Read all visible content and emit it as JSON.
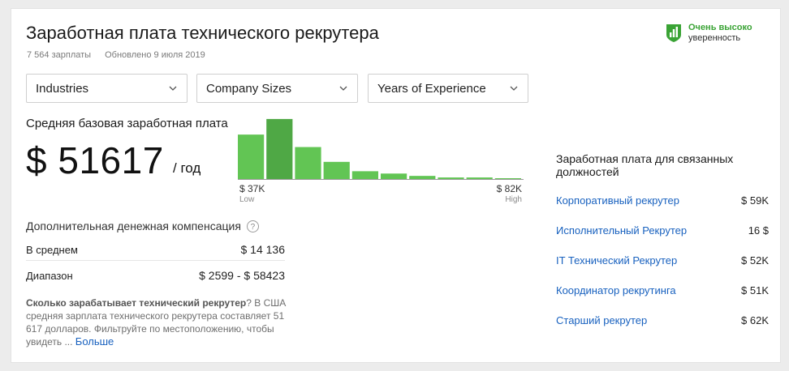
{
  "header": {
    "title": "Заработная плата технического рекрутера",
    "salary_count": "7 564 зарплаты",
    "updated": "Обновлено 9 июля 2019"
  },
  "confidence": {
    "level": "Очень высоко",
    "label": "уверенность",
    "color": "#3aa335",
    "icon": "shield-chart-icon"
  },
  "filters": [
    {
      "label": "Industries",
      "icon": "chevron-down-icon"
    },
    {
      "label": "Company Sizes",
      "icon": "chevron-down-icon"
    },
    {
      "label": "Years of Experience",
      "icon": "chevron-down-icon"
    }
  ],
  "base_pay": {
    "label": "Средняя базовая заработная плата",
    "amount": "$ 51617",
    "period": "/ год"
  },
  "chart_data": {
    "type": "bar",
    "title": "",
    "xlabel": "",
    "ylabel": "",
    "categories": [
      "1",
      "2",
      "3",
      "4",
      "5",
      "6",
      "7",
      "8",
      "9",
      "10"
    ],
    "values": [
      57,
      77,
      41,
      22,
      10,
      7,
      4,
      2,
      2,
      1
    ],
    "ylim": [
      0,
      80
    ],
    "highlight_index": 1,
    "colors": {
      "bar": "#62c554",
      "highlight": "#4fa845"
    },
    "low_value": "$ 37K",
    "low_label": "Low",
    "high_value": "$ 82K",
    "high_label": "High"
  },
  "additional": {
    "title": "Дополнительная денежная компенсация",
    "help_icon": "question-circle-icon",
    "help_glyph": "?",
    "average_label": "В среднем",
    "average_value": "$ 14 136",
    "range_label": "Диапазон",
    "range_value": "$ 2599 - $ 58423"
  },
  "description": {
    "question": "Сколько зарабатывает технический рекрутер",
    "question_mark": "?",
    "text": "В США средняя зарплата технического рекрутера составляет 51 617 долларов. Фильтруйте по местоположению, чтобы увидеть ...",
    "more_link": "Больше"
  },
  "related": {
    "title": "Заработная плата для связанных должностей",
    "items": [
      {
        "name": "Корпоративный рекрутер",
        "amount": "$ 59K"
      },
      {
        "name": "Исполнительный Рекрутер",
        "amount": "16 $"
      },
      {
        "name": "IT Технический Рекрутер",
        "amount": "$ 52K"
      },
      {
        "name": "Координатор рекрутинга",
        "amount": "$ 51K"
      },
      {
        "name": "Старший рекрутер",
        "amount": "$ 62K"
      }
    ]
  }
}
